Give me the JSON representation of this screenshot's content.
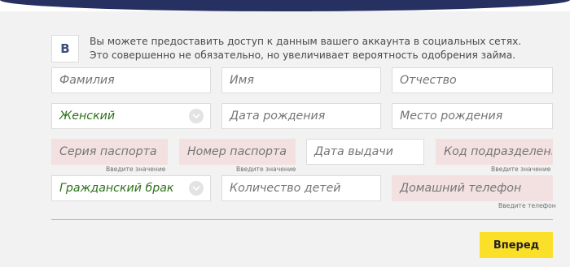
{
  "social": {
    "vk_icon": "vk-icon",
    "vk_letter": "B",
    "line1": "Вы можете предоставить доступ к данным вашего аккаунта в социальных сетях.",
    "line2": "Это совершенно не обязательно, но увеличивает вероятность одобрения займа."
  },
  "fields": {
    "last_name": {
      "placeholder": "Фамилия"
    },
    "first_name": {
      "placeholder": "Имя"
    },
    "middle_name": {
      "placeholder": "Отчество"
    },
    "gender": {
      "value": "Женский",
      "icon": "chevron-down-icon"
    },
    "birth_date": {
      "placeholder": "Дата рождения"
    },
    "birth_place": {
      "placeholder": "Место рождения"
    },
    "passport_series": {
      "placeholder": "Серия паспорта",
      "hint": "Введите значение"
    },
    "passport_number": {
      "placeholder": "Номер паспорта",
      "hint": "Введите значение"
    },
    "issue_date": {
      "placeholder": "Дата выдачи"
    },
    "division_code": {
      "placeholder": "Код подразделения",
      "hint": "Введите значение"
    },
    "marital_status": {
      "value": "Гражданский брак",
      "icon": "chevron-down-icon"
    },
    "children_count": {
      "placeholder": "Количество детей"
    },
    "home_phone": {
      "placeholder": "Домашний телефон",
      "hint": "Введите телефон"
    }
  },
  "submit_label": "Вперед",
  "colors": {
    "header_bg": "#263061",
    "invalid_bg": "#f3e1e1",
    "select_text": "#2b7318",
    "button_bg": "#fbe02a"
  }
}
